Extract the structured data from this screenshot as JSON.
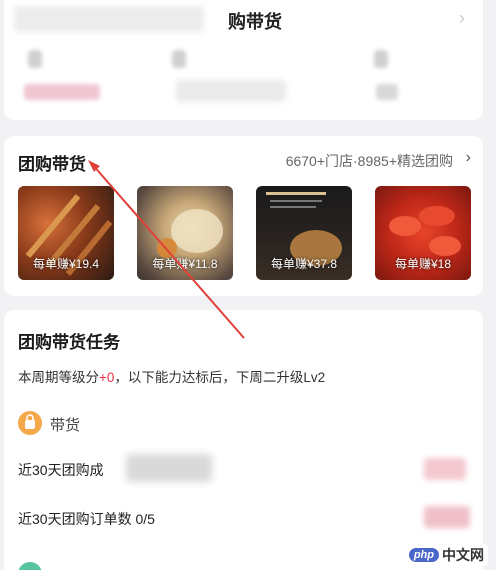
{
  "top_card": {
    "title": "购带货"
  },
  "group_buy": {
    "title": "团购带货",
    "stats": "6670+门店·8985+精选团购",
    "products": [
      {
        "earning": "每单赚¥19.4"
      },
      {
        "earning": "每单赚¥11.8"
      },
      {
        "earning": "每单赚¥37.8"
      },
      {
        "earning": "每单赚¥18"
      }
    ]
  },
  "task": {
    "title": "团购带货任务",
    "desc_prefix": "本周期等级分",
    "desc_score": "+0",
    "desc_suffix": "，以下能力达标后，下周二升级Lv2",
    "goods_label": "带货",
    "metrics": [
      {
        "label": "近30天团购成"
      },
      {
        "label": "近30天团购订单数 0/5"
      }
    ]
  },
  "watermark": {
    "badge": "php",
    "text": "中文网"
  },
  "colors": {
    "accent_red": "#e8334a",
    "goods_icon": "#f4a84a",
    "annotation_arrow": "#e0403a"
  }
}
